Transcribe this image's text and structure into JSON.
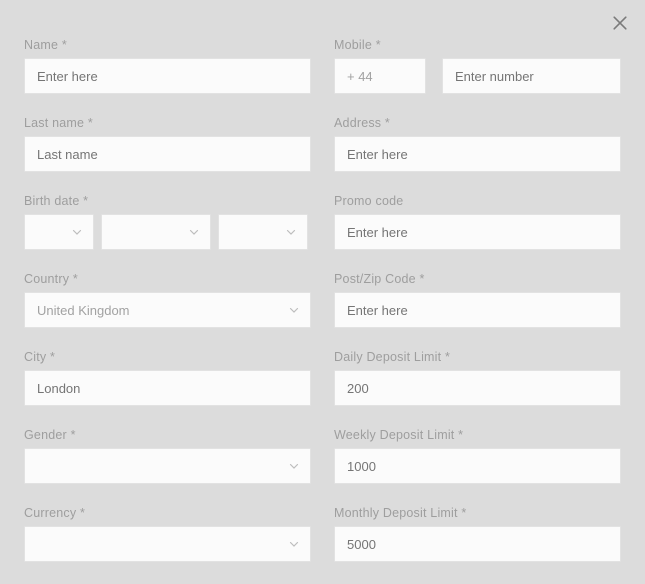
{
  "modal": {
    "close_label": "×",
    "close_icon": "close-icon"
  },
  "icons": {
    "chevron_down": "chevron-down-icon"
  },
  "colors": {
    "background": "#dcdcdc",
    "field_background": "#fbfbfb",
    "field_border": "#e2e2e2",
    "label_text": "#9e9e9e",
    "placeholder_text": "#a8a8a8",
    "close_icon": "#7a7a7a"
  },
  "form": {
    "left": {
      "name": {
        "label": "Name *",
        "placeholder": "Enter here",
        "value": ""
      },
      "last_name": {
        "label": "Last name *",
        "placeholder": "Last name",
        "value": ""
      },
      "birth_date": {
        "label": "Birth date *",
        "day": {
          "value": "",
          "placeholder": ""
        },
        "month": {
          "value": "",
          "placeholder": ""
        },
        "year": {
          "value": "",
          "placeholder": ""
        }
      },
      "country": {
        "label": "Country *",
        "value": "United Kingdom"
      },
      "city": {
        "label": "City *",
        "placeholder": "London",
        "value": ""
      },
      "gender": {
        "label": "Gender *",
        "value": ""
      },
      "currency": {
        "label": "Currency *",
        "value": ""
      }
    },
    "right": {
      "mobile": {
        "label": "Mobile *",
        "prefix_value": "+ 44",
        "number_placeholder": "Enter number",
        "number_value": ""
      },
      "address": {
        "label": "Address *",
        "placeholder": "Enter here",
        "value": ""
      },
      "promo_code": {
        "label": "Promo code",
        "placeholder": "Enter here",
        "value": ""
      },
      "post_zip_code": {
        "label": "Post/Zip Code *",
        "placeholder": "Enter here",
        "value": ""
      },
      "daily_deposit_limit": {
        "label": "Daily Deposit Limit *",
        "placeholder": "200",
        "value": ""
      },
      "weekly_deposit_limit": {
        "label": "Weekly Deposit Limit *",
        "placeholder": "1000",
        "value": ""
      },
      "monthly_deposit_limit": {
        "label": "Monthly Deposit Limit *",
        "placeholder": "5000",
        "value": ""
      }
    }
  }
}
